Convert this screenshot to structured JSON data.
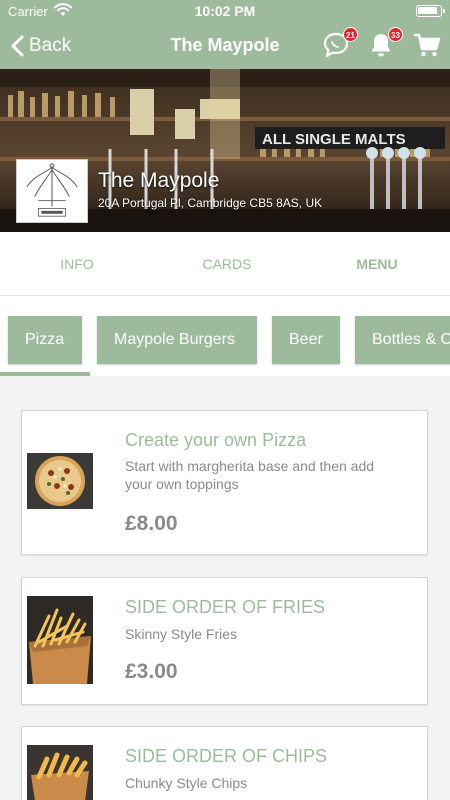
{
  "status_bar": {
    "carrier": "Carrier",
    "time": "10:02 PM"
  },
  "nav": {
    "back_label": "Back",
    "title": "The Maypole",
    "chat_badge": "21",
    "bell_badge": "33",
    "icons": [
      "chat-icon",
      "bell-icon",
      "cart-icon"
    ]
  },
  "venue": {
    "name": "The Maypole",
    "address": "20A Portugal Pl, Cambridge CB5 8AS, UK"
  },
  "tabs": [
    {
      "label": "INFO"
    },
    {
      "label": "CARDS"
    },
    {
      "label": "MENU",
      "active": true
    }
  ],
  "categories": [
    {
      "label": "Pizza",
      "active": true
    },
    {
      "label": "Maypole Burgers"
    },
    {
      "label": "Beer"
    },
    {
      "label": "Bottles & Cans"
    }
  ],
  "items": [
    {
      "title": "Create your own Pizza",
      "description": "Start with margherita base and then add your own toppings",
      "price": "£8.00"
    },
    {
      "title": "SIDE ORDER OF FRIES",
      "description": "Skinny Style Fries",
      "price": "£3.00"
    },
    {
      "title": "SIDE ORDER OF CHIPS",
      "description": "Chunky Style Chips",
      "price": ""
    }
  ],
  "colors": {
    "accent": "#9dbb9c",
    "badge": "#e0262b",
    "text_muted": "#8a8a8a"
  }
}
